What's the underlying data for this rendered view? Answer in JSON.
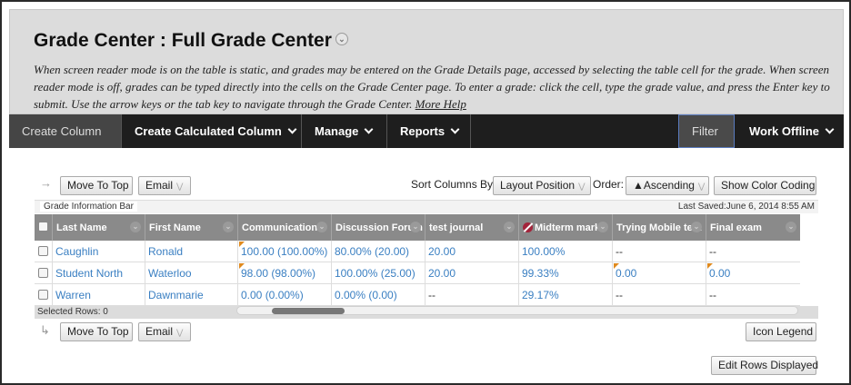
{
  "header": {
    "title": "Grade Center : Full Grade Center",
    "description": "When screen reader mode is on the table is static, and grades may be entered on the Grade Details page, accessed by selecting the table cell for the grade. When screen reader mode is off, grades can be typed directly into the cells on the Grade Center page. To enter a grade: click the cell, type the grade value, and press the Enter key to submit. Use the arrow keys or the tab key to navigate through the Grade Center.",
    "help_link": "More Help"
  },
  "action_bar": {
    "create_column": "Create Column",
    "create_calculated_column": "Create Calculated Column",
    "manage": "Manage",
    "reports": "Reports",
    "filter": "Filter",
    "work_offline": "Work Offline"
  },
  "toolbar_top": {
    "move_to_top": "Move To Top",
    "email": "Email",
    "sort_label": "Sort Columns By:",
    "sort_value": "Layout Position",
    "order_label": "Order:",
    "order_value": "▲Ascending",
    "color_coding": "Show Color Coding"
  },
  "info_bar": {
    "label": "Grade Information Bar",
    "last_saved": "Last Saved:June 6, 2014 8:55 AM"
  },
  "grid": {
    "columns": [
      "Last Name",
      "First Name",
      "Communication",
      "Discussion Forum",
      "test journal",
      "Midterm mark",
      "Trying Mobile test",
      "Final exam"
    ],
    "rows": [
      {
        "last": "Caughlin",
        "first": "Ronald",
        "c1": "100.00 (100.00%)",
        "c2": "80.00% (20.00)",
        "c3": "20.00",
        "c4": "100.00%",
        "c5": "--",
        "c6": "--"
      },
      {
        "last": "Student North",
        "first": "Waterloo",
        "c1": "98.00 (98.00%)",
        "c2": "100.00% (25.00)",
        "c3": "20.00",
        "c4": "99.33%",
        "c5": "0.00",
        "c6": "0.00"
      },
      {
        "last": "Warren",
        "first": "Dawnmarie",
        "c1": "0.00 (0.00%)",
        "c2": "0.00% (0.00)",
        "c3": "--",
        "c4": "29.17%",
        "c5": "--",
        "c6": "--"
      }
    ]
  },
  "selected_rows": "Selected Rows: 0",
  "toolbar_bottom": {
    "move_to_top": "Move To Top",
    "email": "Email",
    "icon_legend": "Icon Legend",
    "edit_rows": "Edit Rows Displayed"
  },
  "colors": {
    "action_bar_bg": "#1e1e1e",
    "header_bg": "#dcdcdc",
    "grid_header_bg": "#8a8a8a",
    "link": "#3a7fc2",
    "flag": "#e08a1e"
  }
}
